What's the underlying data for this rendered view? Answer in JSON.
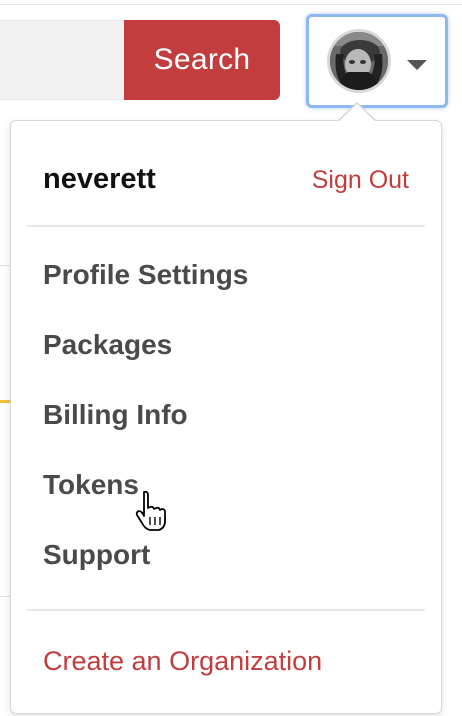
{
  "header": {
    "search_button_label": "Search"
  },
  "user_menu": {
    "username": "neverett",
    "sign_out_label": "Sign Out",
    "items": [
      {
        "label": "Profile Settings"
      },
      {
        "label": "Packages"
      },
      {
        "label": "Billing Info"
      },
      {
        "label": "Tokens"
      },
      {
        "label": "Support"
      }
    ],
    "create_org_label": "Create an Organization"
  },
  "colors": {
    "brand_red": "#c23d3d",
    "focus_ring": "#8fb8f2",
    "menu_text": "#4a4a4a"
  },
  "icons": {
    "avatar": "user-avatar",
    "caret": "caret-down-icon",
    "cursor": "hand-pointer-cursor"
  }
}
